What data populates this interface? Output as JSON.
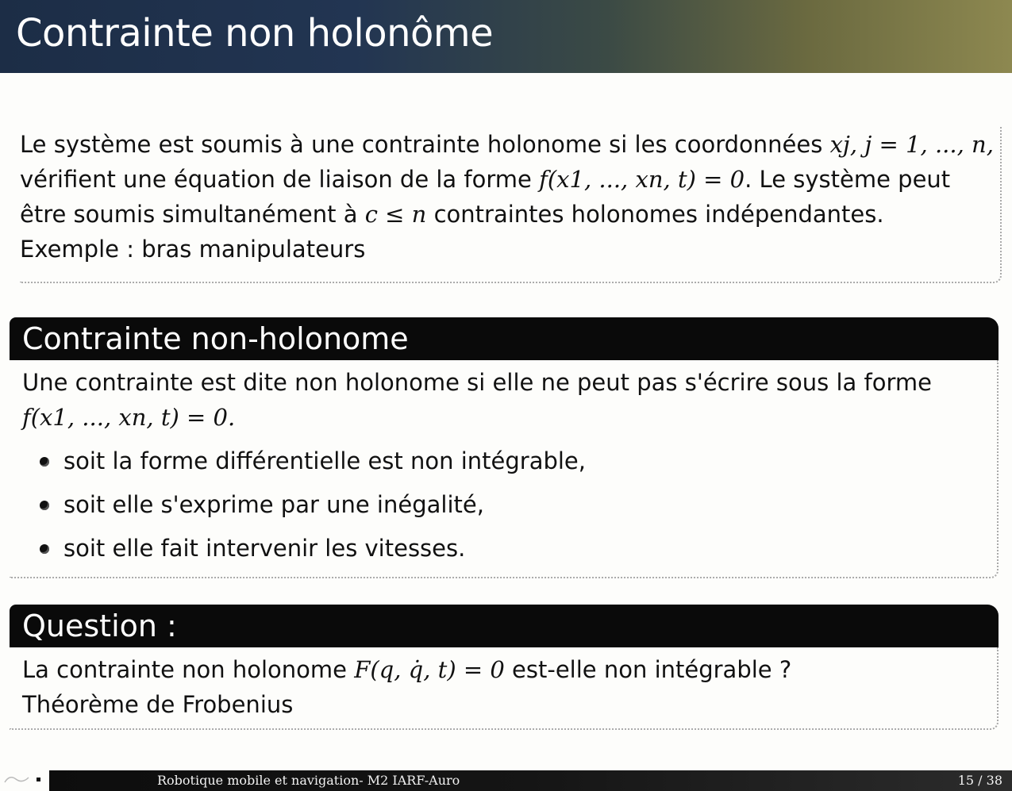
{
  "slide": {
    "title": "Contrainte non holonôme"
  },
  "intro": {
    "line1_a": "Le système est soumis à une contrainte holonome si les coordonnées ",
    "line1_math": "xj, j = 1, ..., n,",
    "line2_a": "vérifient une équation de liaison de la forme ",
    "line2_math": "f(x1, ..., xn, t) = 0",
    "line2_b": ". Le système peut",
    "line3_a": "être soumis simultanément à ",
    "line3_math": "c ≤ n",
    "line3_b": " contraintes holonomes indépendantes.",
    "line4": "Exemple : bras manipulateurs"
  },
  "nonholonomic_block": {
    "heading": "Contrainte non-holonome",
    "text": "Une contrainte est dite non holonome si elle ne peut pas s'écrire sous la forme",
    "formula": "f(x1, ..., xn, t) = 0.",
    "bullets": [
      "soit la forme différentielle est non intégrable,",
      "soit elle s'exprime par une inégalité,",
      "soit elle fait intervenir les vitesses."
    ]
  },
  "question_block": {
    "heading": "Question :",
    "line1_a": "La contrainte non holonome ",
    "line1_math": "F(q, q̇, t) = 0",
    "line1_b": " est-elle non intégrable ?",
    "line2": "Théorème de Frobenius"
  },
  "footer": {
    "course": "Robotique mobile et navigation- M2 IARF-Auro",
    "page": "15 / 38"
  }
}
